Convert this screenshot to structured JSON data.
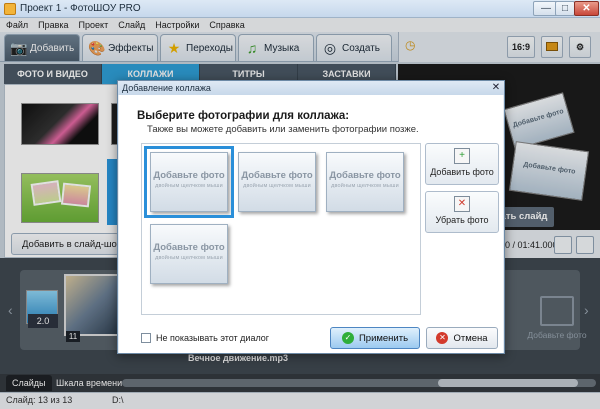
{
  "window": {
    "title": "Проект 1 - ФотоШОУ PRO",
    "min": "—",
    "max": "□",
    "close": "✕"
  },
  "menu": [
    "Файл",
    "Правка",
    "Проект",
    "Слайд",
    "Настройки",
    "Справка"
  ],
  "main_tabs": [
    {
      "label": "Добавить",
      "icon": "camera-icon"
    },
    {
      "label": "Эффекты",
      "icon": "palette-icon"
    },
    {
      "label": "Переходы",
      "icon": "star-icon"
    },
    {
      "label": "Музыка",
      "icon": "music-note-icon"
    },
    {
      "label": "Создать",
      "icon": "disc-icon"
    }
  ],
  "toolbar": {
    "aspect": "16:9"
  },
  "sub_tabs": [
    "ФОТО И ВИДЕО",
    "КОЛЛАЖИ",
    "ТИТРЫ",
    "ЗАСТАВКИ"
  ],
  "left_panel": {
    "add_to_slideshow": "Добавить в слайд-шоу"
  },
  "preview": {
    "card_text": "Добавьте фото",
    "slide_button": "ать слайд",
    "timecode": "0 / 01:41.000"
  },
  "timeline": {
    "slide_duration": "2.0",
    "slide_number": "11",
    "music_track": "Вечное движение.mp3",
    "add_photo_placeholder": "Добавьте фото"
  },
  "bottom_tabs": [
    "Слайды",
    "Шкала времени"
  ],
  "status": {
    "slide_count": "Слайд: 13 из 13",
    "path": "D:\\"
  },
  "dialog": {
    "title": "Добавление коллажа",
    "close": "✕",
    "heading": "Выберите фотографии для коллажа:",
    "subheading": "Также вы можете добавить или заменить фотографии позже.",
    "cells": [
      {
        "title": "Добавьте фото",
        "hint": "двойным щелчком мыши"
      },
      {
        "title": "Добавьте фото",
        "hint": "двойным щелчком мыши"
      },
      {
        "title": "Добавьте фото",
        "hint": "двойным щелчком мыши"
      },
      {
        "title": "Добавьте фото",
        "hint": "двойным щелчком мыши"
      }
    ],
    "add_photo": "Добавить фото",
    "remove_photo": "Убрать фото",
    "dont_show": "Не показывать этот диалог",
    "apply": "Применить",
    "cancel": "Отмена"
  }
}
